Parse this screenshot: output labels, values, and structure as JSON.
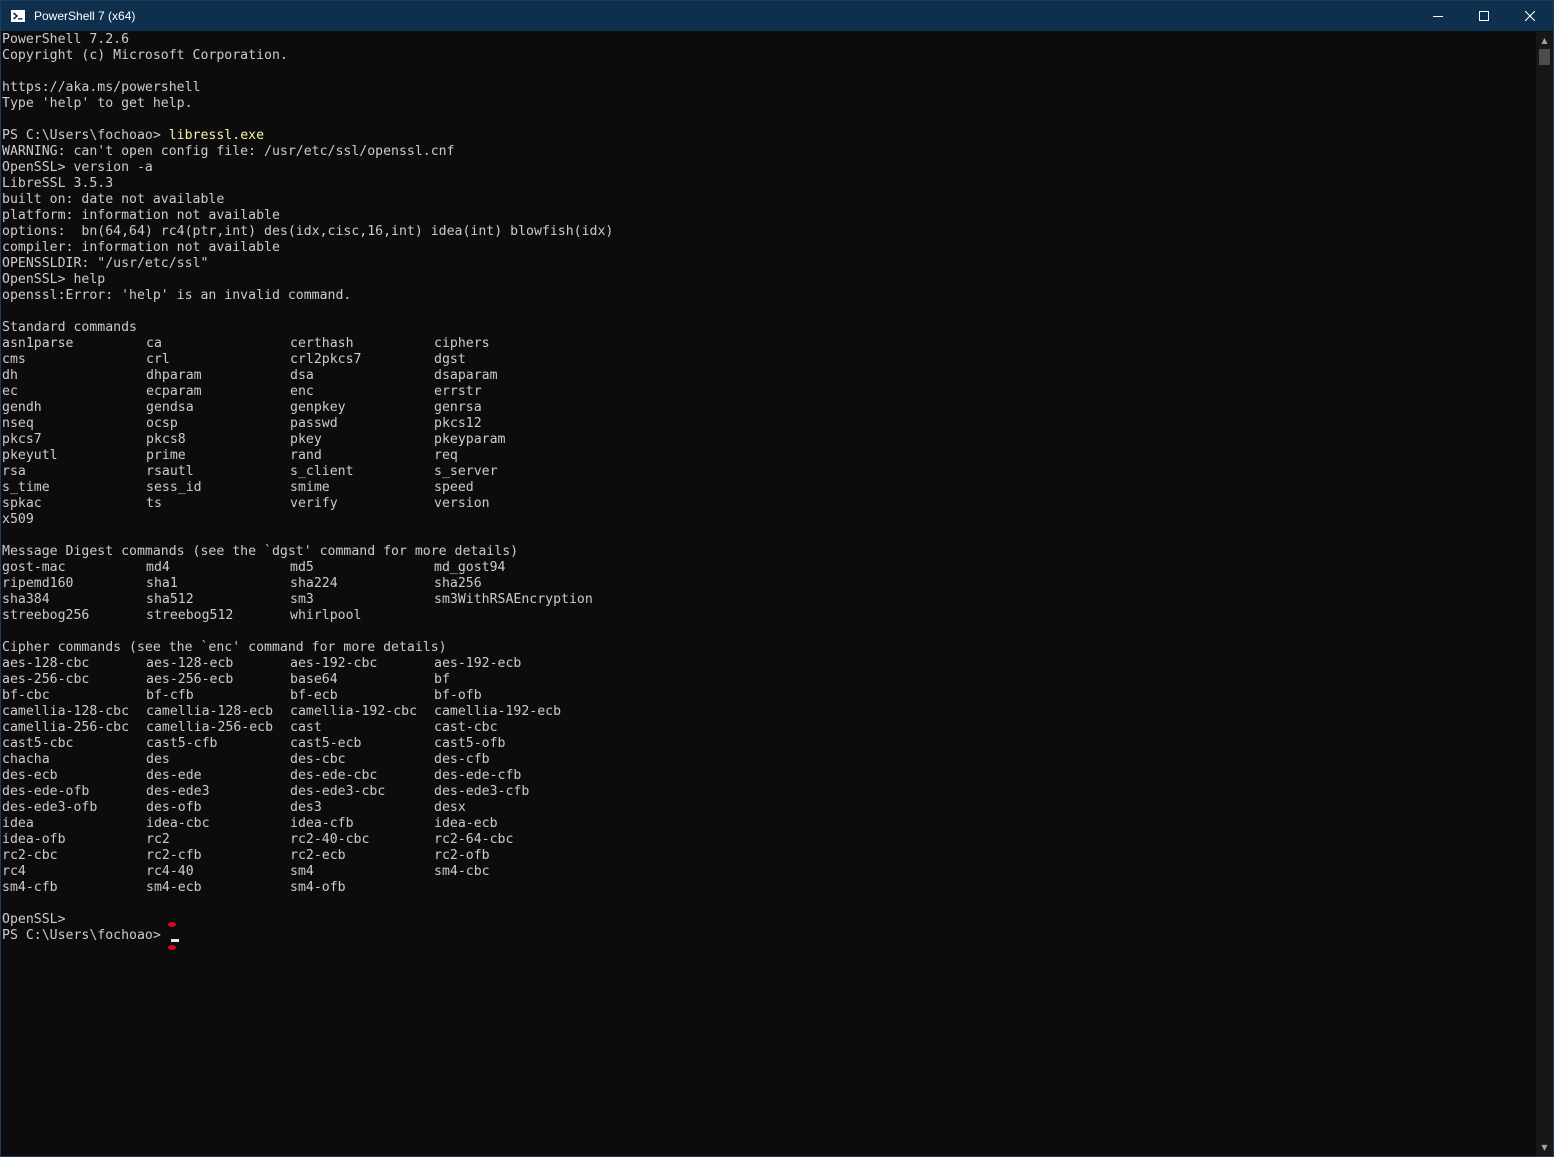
{
  "window": {
    "title": "PowerShell 7 (x64)",
    "minimize_glyph": "—",
    "maximize_glyph": "☐",
    "close_glyph": "✕",
    "icon": "powershell-icon"
  },
  "console": {
    "header_lines": [
      "PowerShell 7.2.6",
      "Copyright (c) Microsoft Corporation.",
      "",
      "https://aka.ms/powershell",
      "Type 'help' to get help.",
      ""
    ],
    "prompt": "PS C:\\Users\\fochoao> ",
    "first_command": "libressl.exe",
    "output_lines": [
      "WARNING: can't open config file: /usr/etc/ssl/openssl.cnf",
      "OpenSSL> version -a",
      "LibreSSL 3.5.3",
      "built on: date not available",
      "platform: information not available",
      "options:  bn(64,64) rc4(ptr,int) des(idx,cisc,16,int) idea(int) blowfish(idx)",
      "compiler: information not available",
      "OPENSSLDIR: \"/usr/etc/ssl\"",
      "OpenSSL> help",
      "openssl:Error: 'help' is an invalid command.",
      ""
    ],
    "sections": [
      {
        "title": "Standard commands",
        "rows": [
          [
            "asn1parse",
            "ca",
            "certhash",
            "ciphers"
          ],
          [
            "cms",
            "crl",
            "crl2pkcs7",
            "dgst"
          ],
          [
            "dh",
            "dhparam",
            "dsa",
            "dsaparam"
          ],
          [
            "ec",
            "ecparam",
            "enc",
            "errstr"
          ],
          [
            "gendh",
            "gendsa",
            "genpkey",
            "genrsa"
          ],
          [
            "nseq",
            "ocsp",
            "passwd",
            "pkcs12"
          ],
          [
            "pkcs7",
            "pkcs8",
            "pkey",
            "pkeyparam"
          ],
          [
            "pkeyutl",
            "prime",
            "rand",
            "req"
          ],
          [
            "rsa",
            "rsautl",
            "s_client",
            "s_server"
          ],
          [
            "s_time",
            "sess_id",
            "smime",
            "speed"
          ],
          [
            "spkac",
            "ts",
            "verify",
            "version"
          ],
          [
            "x509"
          ]
        ]
      },
      {
        "title": "Message Digest commands (see the `dgst' command for more details)",
        "rows": [
          [
            "gost-mac",
            "md4",
            "md5",
            "md_gost94"
          ],
          [
            "ripemd160",
            "sha1",
            "sha224",
            "sha256"
          ],
          [
            "sha384",
            "sha512",
            "sm3",
            "sm3WithRSAEncryption"
          ],
          [
            "streebog256",
            "streebog512",
            "whirlpool"
          ]
        ]
      },
      {
        "title": "Cipher commands (see the `enc' command for more details)",
        "rows": [
          [
            "aes-128-cbc",
            "aes-128-ecb",
            "aes-192-cbc",
            "aes-192-ecb"
          ],
          [
            "aes-256-cbc",
            "aes-256-ecb",
            "base64",
            "bf"
          ],
          [
            "bf-cbc",
            "bf-cfb",
            "bf-ecb",
            "bf-ofb"
          ],
          [
            "camellia-128-cbc",
            "camellia-128-ecb",
            "camellia-192-cbc",
            "camellia-192-ecb"
          ],
          [
            "camellia-256-cbc",
            "camellia-256-ecb",
            "cast",
            "cast-cbc"
          ],
          [
            "cast5-cbc",
            "cast5-cfb",
            "cast5-ecb",
            "cast5-ofb"
          ],
          [
            "chacha",
            "des",
            "des-cbc",
            "des-cfb"
          ],
          [
            "des-ecb",
            "des-ede",
            "des-ede-cbc",
            "des-ede-cfb"
          ],
          [
            "des-ede-ofb",
            "des-ede3",
            "des-ede3-cbc",
            "des-ede3-cfb"
          ],
          [
            "des-ede3-ofb",
            "des-ofb",
            "des3",
            "desx"
          ],
          [
            "idea",
            "idea-cbc",
            "idea-cfb",
            "idea-ecb"
          ],
          [
            "idea-ofb",
            "rc2",
            "rc2-40-cbc",
            "rc2-64-cbc"
          ],
          [
            "rc2-cbc",
            "rc2-cfb",
            "rc2-ecb",
            "rc2-ofb"
          ],
          [
            "rc4",
            "rc4-40",
            "sm4",
            "sm4-cbc"
          ],
          [
            "sm4-cfb",
            "sm4-ecb",
            "sm4-ofb"
          ]
        ]
      }
    ],
    "closing_lines": [
      "OpenSSL>"
    ],
    "final_prompt": "PS C:\\Users\\fochoao> "
  },
  "colors": {
    "background": "#0c0c0c",
    "foreground": "#cccccc",
    "command": "#f9f1a5",
    "titlebar": "#0f2f4f"
  }
}
